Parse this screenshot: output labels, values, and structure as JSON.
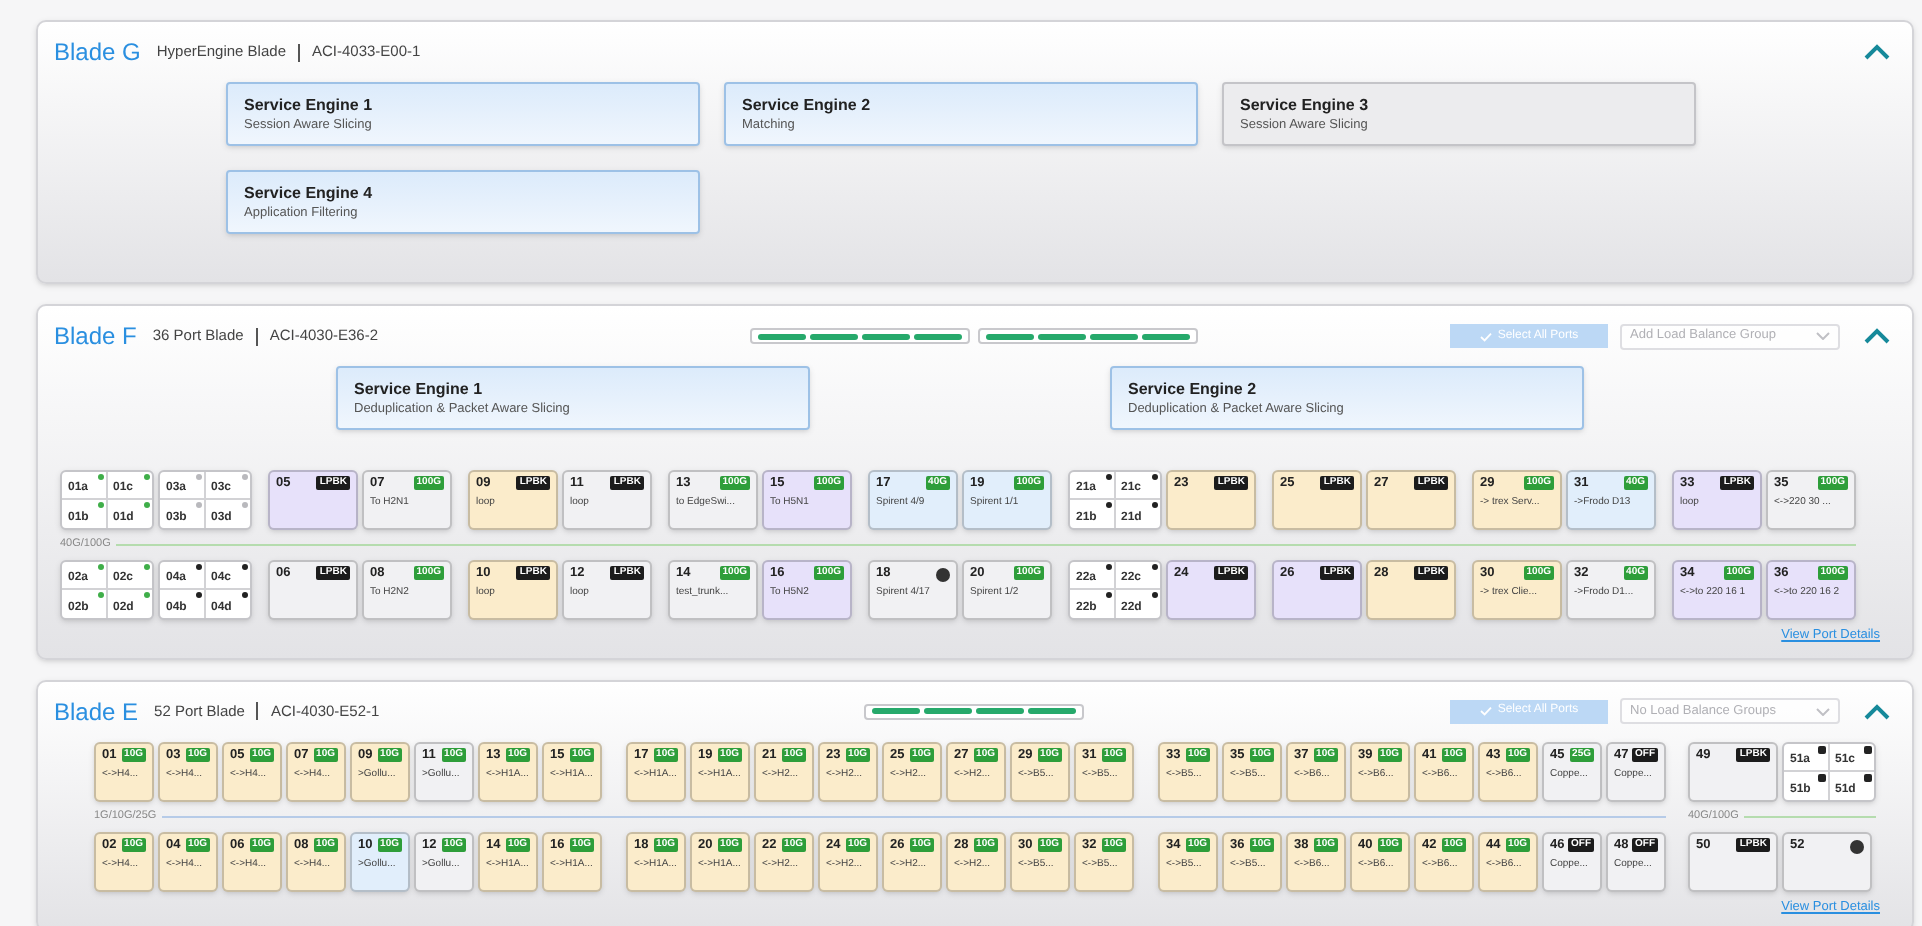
{
  "blades": [
    {
      "name": "Blade G",
      "type": "HyperEngine Blade",
      "model": "ACI-4033-E00-1",
      "expanded": true,
      "engines": [
        {
          "title": "Service Engine 1",
          "subtitle": "Session Aware Slicing",
          "active": true
        },
        {
          "title": "Service Engine 2",
          "subtitle": "Matching",
          "active": true
        },
        {
          "title": "Service Engine 3",
          "subtitle": "Session Aware Slicing",
          "active": false
        },
        {
          "title": "Service Engine 4",
          "subtitle": "Application Filtering",
          "active": true
        }
      ]
    },
    {
      "name": "Blade F",
      "type": "36 Port Blade",
      "model": "ACI-4030-E36-2",
      "expanded": true,
      "link_groups": [
        {
          "lanes": [
            {
              "up": true
            },
            {
              "up": true
            },
            {
              "up": true
            },
            {
              "up": true
            }
          ]
        },
        {
          "lanes": [
            {
              "up": true
            },
            {
              "up": true
            },
            {
              "up": true
            },
            {
              "up": true
            }
          ]
        }
      ],
      "select_all": {
        "label": "Select All Ports",
        "disabled": true
      },
      "load_balance": {
        "placeholder": "Add Load Balance Group",
        "disabled": true
      },
      "engines": [
        {
          "title": "Service Engine 1",
          "subtitle": "Deduplication & Packet Aware Slicing",
          "active": true
        },
        {
          "title": "Service Engine 2",
          "subtitle": "Deduplication & Packet Aware Slicing",
          "active": true
        }
      ],
      "sections": [
        {
          "speed": "40G/100G",
          "color": "#b5dcae",
          "groups": [
            {
              "columns": [
                {
                  "top": {
                    "kind": "split",
                    "ports": [
                      {
                        "id": "01a",
                        "kind": "dot",
                        "color": "#3fae49"
                      },
                      {
                        "id": "01c",
                        "kind": "dot",
                        "color": "#3fae49"
                      },
                      {
                        "id": "01b",
                        "kind": "dot",
                        "color": "#3fae49"
                      },
                      {
                        "id": "01d",
                        "kind": "dot",
                        "color": "#3fae49"
                      }
                    ]
                  },
                  "bottom": {
                    "kind": "split",
                    "ports": [
                      {
                        "id": "02a",
                        "kind": "dot",
                        "color": "#3fae49"
                      },
                      {
                        "id": "02c",
                        "kind": "dot",
                        "color": "#3fae49"
                      },
                      {
                        "id": "02b",
                        "kind": "dot",
                        "color": "#3fae49"
                      },
                      {
                        "id": "02d",
                        "kind": "dot",
                        "color": "#3fae49"
                      }
                    ]
                  }
                },
                {
                  "top": {
                    "kind": "split",
                    "ports": [
                      {
                        "id": "03a",
                        "kind": "dot",
                        "color": "#b9b9bd"
                      },
                      {
                        "id": "03c",
                        "kind": "dot",
                        "color": "#b9b9bd"
                      },
                      {
                        "id": "03b",
                        "kind": "dot",
                        "color": "#b9b9bd"
                      },
                      {
                        "id": "03d",
                        "kind": "dot",
                        "color": "#b9b9bd"
                      }
                    ]
                  },
                  "bottom": {
                    "kind": "split",
                    "ports": [
                      {
                        "id": "04a",
                        "kind": "dot",
                        "color": "#222222"
                      },
                      {
                        "id": "04c",
                        "kind": "dot",
                        "color": "#222222"
                      },
                      {
                        "id": "04b",
                        "kind": "dot",
                        "color": "#222222"
                      },
                      {
                        "id": "04d",
                        "kind": "dot",
                        "color": "#222222"
                      }
                    ]
                  }
                }
              ]
            },
            {
              "columns": [
                {
                  "top": {
                    "kind": "port",
                    "id": "05",
                    "badge": {
                      "kind": "dark",
                      "text": "LPBK"
                    },
                    "color": "#e7e1fa"
                  },
                  "bottom": {
                    "kind": "port",
                    "id": "06",
                    "badge": {
                      "kind": "dark",
                      "text": "LPBK"
                    },
                    "color": "#f1f1f3"
                  }
                },
                {
                  "top": {
                    "kind": "port",
                    "id": "07",
                    "badge": {
                      "kind": "green",
                      "text": "100G"
                    },
                    "label": "To H2N1",
                    "color": "#f1f1f3"
                  },
                  "bottom": {
                    "kind": "port",
                    "id": "08",
                    "badge": {
                      "kind": "green",
                      "text": "100G"
                    },
                    "label": "To H2N2",
                    "color": "#f1f1f3"
                  }
                }
              ]
            },
            {
              "columns": [
                {
                  "top": {
                    "kind": "port",
                    "id": "09",
                    "badge": {
                      "kind": "dark",
                      "text": "LPBK"
                    },
                    "label": "loop",
                    "color": "#fbeccb"
                  },
                  "bottom": {
                    "kind": "port",
                    "id": "10",
                    "badge": {
                      "kind": "dark",
                      "text": "LPBK"
                    },
                    "label": "loop",
                    "color": "#fbeccb"
                  }
                },
                {
                  "top": {
                    "kind": "port",
                    "id": "11",
                    "badge": {
                      "kind": "dark",
                      "text": "LPBK"
                    },
                    "label": "loop",
                    "color": "#f1f1f3"
                  },
                  "bottom": {
                    "kind": "port",
                    "id": "12",
                    "badge": {
                      "kind": "dark",
                      "text": "LPBK"
                    },
                    "label": "loop",
                    "color": "#f1f1f3"
                  }
                }
              ]
            },
            {
              "columns": [
                {
                  "top": {
                    "kind": "port",
                    "id": "13",
                    "badge": {
                      "kind": "green",
                      "text": "100G"
                    },
                    "label": "to EdgeSwi...",
                    "color": "#f1f1f3"
                  },
                  "bottom": {
                    "kind": "port",
                    "id": "14",
                    "badge": {
                      "kind": "green",
                      "text": "100G"
                    },
                    "label": "test_trunk...",
                    "color": "#f1f1f3"
                  }
                },
                {
                  "top": {
                    "kind": "port",
                    "id": "15",
                    "badge": {
                      "kind": "green",
                      "text": "100G"
                    },
                    "label": "To H5N1",
                    "color": "#e7e1fa"
                  },
                  "bottom": {
                    "kind": "port",
                    "id": "16",
                    "badge": {
                      "kind": "green",
                      "text": "100G"
                    },
                    "label": "To H5N2",
                    "color": "#e7e1fa"
                  }
                }
              ]
            },
            {
              "columns": [
                {
                  "top": {
                    "kind": "port",
                    "id": "17",
                    "badge": {
                      "kind": "green",
                      "text": "40G"
                    },
                    "label": "Spirent 4/9",
                    "color": "#e1eefb"
                  },
                  "bottom": {
                    "kind": "port",
                    "id": "18",
                    "badge": {
                      "kind": "dot"
                    },
                    "label": "Spirent 4/17",
                    "color": "#f1f1f3"
                  }
                },
                {
                  "top": {
                    "kind": "port",
                    "id": "19",
                    "badge": {
                      "kind": "green",
                      "text": "100G"
                    },
                    "label": "Spirent 1/1",
                    "color": "#e1eefb"
                  },
                  "bottom": {
                    "kind": "port",
                    "id": "20",
                    "badge": {
                      "kind": "green",
                      "text": "100G"
                    },
                    "label": "Spirent 1/2",
                    "color": "#f1f1f3"
                  }
                }
              ]
            },
            {
              "columns": [
                {
                  "top": {
                    "kind": "split",
                    "ports": [
                      {
                        "id": "21a",
                        "kind": "dot",
                        "color": "#222222"
                      },
                      {
                        "id": "21c",
                        "kind": "dot",
                        "color": "#222222"
                      },
                      {
                        "id": "21b",
                        "kind": "dot",
                        "color": "#222222"
                      },
                      {
                        "id": "21d",
                        "kind": "dot",
                        "color": "#222222"
                      }
                    ]
                  },
                  "bottom": {
                    "kind": "split",
                    "ports": [
                      {
                        "id": "22a",
                        "kind": "dot",
                        "color": "#222222"
                      },
                      {
                        "id": "22c",
                        "kind": "dot",
                        "color": "#222222"
                      },
                      {
                        "id": "22b",
                        "kind": "dot",
                        "color": "#222222"
                      },
                      {
                        "id": "22d",
                        "kind": "dot",
                        "color": "#222222"
                      }
                    ]
                  }
                },
                {
                  "top": {
                    "kind": "port",
                    "id": "23",
                    "badge": {
                      "kind": "dark",
                      "text": "LPBK"
                    },
                    "color": "#fbeccb"
                  },
                  "bottom": {
                    "kind": "port",
                    "id": "24",
                    "badge": {
                      "kind": "dark",
                      "text": "LPBK"
                    },
                    "color": "#e7e1fa"
                  }
                }
              ]
            },
            {
              "columns": [
                {
                  "top": {
                    "kind": "port",
                    "id": "25",
                    "badge": {
                      "kind": "dark",
                      "text": "LPBK"
                    },
                    "color": "#fbeccb"
                  },
                  "bottom": {
                    "kind": "port",
                    "id": "26",
                    "badge": {
                      "kind": "dark",
                      "text": "LPBK"
                    },
                    "color": "#e7e1fa"
                  }
                },
                {
                  "top": {
                    "kind": "port",
                    "id": "27",
                    "badge": {
                      "kind": "dark",
                      "text": "LPBK"
                    },
                    "color": "#fbeccb"
                  },
                  "bottom": {
                    "kind": "port",
                    "id": "28",
                    "badge": {
                      "kind": "dark",
                      "text": "LPBK"
                    },
                    "color": "#fbeccb"
                  }
                }
              ]
            },
            {
              "columns": [
                {
                  "top": {
                    "kind": "port",
                    "id": "29",
                    "badge": {
                      "kind": "green",
                      "text": "100G"
                    },
                    "label": "-> trex Serv...",
                    "color": "#fbeccb"
                  },
                  "bottom": {
                    "kind": "port",
                    "id": "30",
                    "badge": {
                      "kind": "green",
                      "text": "100G"
                    },
                    "label": "-> trex Clie...",
                    "color": "#fbeccb"
                  }
                },
                {
                  "top": {
                    "kind": "port",
                    "id": "31",
                    "badge": {
                      "kind": "green",
                      "text": "40G"
                    },
                    "label": "->Frodo D13",
                    "color": "#e1eefb"
                  },
                  "bottom": {
                    "kind": "port",
                    "id": "32",
                    "badge": {
                      "kind": "green",
                      "text": "40G"
                    },
                    "label": "->Frodo D1...",
                    "color": "#f1f1f3"
                  }
                }
              ]
            },
            {
              "columns": [
                {
                  "top": {
                    "kind": "port",
                    "id": "33",
                    "badge": {
                      "kind": "dark",
                      "text": "LPBK"
                    },
                    "label": "loop",
                    "color": "#e7e1fa"
                  },
                  "bottom": {
                    "kind": "port",
                    "id": "34",
                    "badge": {
                      "kind": "green",
                      "text": "100G"
                    },
                    "label": "<->to 220 16 1",
                    "color": "#e7e1fa"
                  }
                },
                {
                  "top": {
                    "kind": "port",
                    "id": "35",
                    "badge": {
                      "kind": "green",
                      "text": "100G"
                    },
                    "label": "<->220 30 ...",
                    "color": "#f1f1f3"
                  },
                  "bottom": {
                    "kind": "port",
                    "id": "36",
                    "badge": {
                      "kind": "green",
                      "text": "100G"
                    },
                    "label": "<->to 220 16 2",
                    "color": "#e7e1fa"
                  }
                }
              ]
            }
          ]
        }
      ],
      "details_link": "View Port Details"
    },
    {
      "name": "Blade E",
      "type": "52 Port Blade",
      "model": "ACI-4030-E52-1",
      "expanded": true,
      "link_groups": [
        {
          "lanes": [
            {
              "up": true
            },
            {
              "up": true
            },
            {
              "up": true
            },
            {
              "up": true
            }
          ]
        }
      ],
      "select_all": {
        "label": "Select All Ports",
        "disabled": true
      },
      "load_balance": {
        "placeholder": "No Load Balance Groups",
        "disabled": true
      },
      "sections": [
        {
          "speed": "1G/10G/25G",
          "color": "#b6cbe8",
          "groups": [
            {
              "columns": [
                {
                  "top": {
                    "kind": "port",
                    "id": "01",
                    "badge": {
                      "kind": "green",
                      "text": "10G"
                    },
                    "label": "<->H4...",
                    "color": "#fbeccb"
                  },
                  "bottom": {
                    "kind": "port",
                    "id": "02",
                    "badge": {
                      "kind": "green",
                      "text": "10G"
                    },
                    "label": "<->H4...",
                    "color": "#fbeccb"
                  }
                },
                {
                  "top": {
                    "kind": "port",
                    "id": "03",
                    "badge": {
                      "kind": "green",
                      "text": "10G"
                    },
                    "label": "<->H4...",
                    "color": "#fbeccb"
                  },
                  "bottom": {
                    "kind": "port",
                    "id": "04",
                    "badge": {
                      "kind": "green",
                      "text": "10G"
                    },
                    "label": "<->H4...",
                    "color": "#fbeccb"
                  }
                },
                {
                  "top": {
                    "kind": "port",
                    "id": "05",
                    "badge": {
                      "kind": "green",
                      "text": "10G"
                    },
                    "label": "<->H4...",
                    "color": "#fbeccb"
                  },
                  "bottom": {
                    "kind": "port",
                    "id": "06",
                    "badge": {
                      "kind": "green",
                      "text": "10G"
                    },
                    "label": "<->H4...",
                    "color": "#fbeccb"
                  }
                },
                {
                  "top": {
                    "kind": "port",
                    "id": "07",
                    "badge": {
                      "kind": "green",
                      "text": "10G"
                    },
                    "label": "<->H4...",
                    "color": "#fbeccb"
                  },
                  "bottom": {
                    "kind": "port",
                    "id": "08",
                    "badge": {
                      "kind": "green",
                      "text": "10G"
                    },
                    "label": "<->H4...",
                    "color": "#fbeccb"
                  }
                },
                {
                  "top": {
                    "kind": "port",
                    "id": "09",
                    "badge": {
                      "kind": "green",
                      "text": "10G"
                    },
                    "label": ">Gollu...",
                    "color": "#fbeccb"
                  },
                  "bottom": {
                    "kind": "port",
                    "id": "10",
                    "badge": {
                      "kind": "green",
                      "text": "10G"
                    },
                    "label": ">Gollu...",
                    "color": "#e1eefb"
                  }
                },
                {
                  "top": {
                    "kind": "port",
                    "id": "11",
                    "badge": {
                      "kind": "green",
                      "text": "10G"
                    },
                    "label": ">Gollu...",
                    "color": "#f1f1f3"
                  },
                  "bottom": {
                    "kind": "port",
                    "id": "12",
                    "badge": {
                      "kind": "green",
                      "text": "10G"
                    },
                    "label": ">Gollu...",
                    "color": "#f1f1f3"
                  }
                },
                {
                  "top": {
                    "kind": "port",
                    "id": "13",
                    "badge": {
                      "kind": "green",
                      "text": "10G"
                    },
                    "label": "<->H1A...",
                    "color": "#fbeccb"
                  },
                  "bottom": {
                    "kind": "port",
                    "id": "14",
                    "badge": {
                      "kind": "green",
                      "text": "10G"
                    },
                    "label": "<->H1A...",
                    "color": "#fbeccb"
                  }
                },
                {
                  "top": {
                    "kind": "port",
                    "id": "15",
                    "badge": {
                      "kind": "green",
                      "text": "10G"
                    },
                    "label": "<->H1A...",
                    "color": "#fbeccb"
                  },
                  "bottom": {
                    "kind": "port",
                    "id": "16",
                    "badge": {
                      "kind": "green",
                      "text": "10G"
                    },
                    "label": "<->H1A...",
                    "color": "#fbeccb"
                  }
                }
              ]
            },
            {
              "columns": [
                {
                  "top": {
                    "kind": "port",
                    "id": "17",
                    "badge": {
                      "kind": "green",
                      "text": "10G"
                    },
                    "label": "<->H1A...",
                    "color": "#fbeccb"
                  },
                  "bottom": {
                    "kind": "port",
                    "id": "18",
                    "badge": {
                      "kind": "green",
                      "text": "10G"
                    },
                    "label": "<->H1A...",
                    "color": "#fbeccb"
                  }
                },
                {
                  "top": {
                    "kind": "port",
                    "id": "19",
                    "badge": {
                      "kind": "green",
                      "text": "10G"
                    },
                    "label": "<->H1A...",
                    "color": "#fbeccb"
                  },
                  "bottom": {
                    "kind": "port",
                    "id": "20",
                    "badge": {
                      "kind": "green",
                      "text": "10G"
                    },
                    "label": "<->H1A...",
                    "color": "#fbeccb"
                  }
                },
                {
                  "top": {
                    "kind": "port",
                    "id": "21",
                    "badge": {
                      "kind": "green",
                      "text": "10G"
                    },
                    "label": "<->H2...",
                    "color": "#fbeccb"
                  },
                  "bottom": {
                    "kind": "port",
                    "id": "22",
                    "badge": {
                      "kind": "green",
                      "text": "10G"
                    },
                    "label": "<->H2...",
                    "color": "#fbeccb"
                  }
                },
                {
                  "top": {
                    "kind": "port",
                    "id": "23",
                    "badge": {
                      "kind": "green",
                      "text": "10G"
                    },
                    "label": "<->H2...",
                    "color": "#fbeccb"
                  },
                  "bottom": {
                    "kind": "port",
                    "id": "24",
                    "badge": {
                      "kind": "green",
                      "text": "10G"
                    },
                    "label": "<->H2...",
                    "color": "#fbeccb"
                  }
                },
                {
                  "top": {
                    "kind": "port",
                    "id": "25",
                    "badge": {
                      "kind": "green",
                      "text": "10G"
                    },
                    "label": "<->H2...",
                    "color": "#fbeccb"
                  },
                  "bottom": {
                    "kind": "port",
                    "id": "26",
                    "badge": {
                      "kind": "green",
                      "text": "10G"
                    },
                    "label": "<->H2...",
                    "color": "#fbeccb"
                  }
                },
                {
                  "top": {
                    "kind": "port",
                    "id": "27",
                    "badge": {
                      "kind": "green",
                      "text": "10G"
                    },
                    "label": "<->H2...",
                    "color": "#fbeccb"
                  },
                  "bottom": {
                    "kind": "port",
                    "id": "28",
                    "badge": {
                      "kind": "green",
                      "text": "10G"
                    },
                    "label": "<->H2...",
                    "color": "#fbeccb"
                  }
                },
                {
                  "top": {
                    "kind": "port",
                    "id": "29",
                    "badge": {
                      "kind": "green",
                      "text": "10G"
                    },
                    "label": "<->B5...",
                    "color": "#fbeccb"
                  },
                  "bottom": {
                    "kind": "port",
                    "id": "30",
                    "badge": {
                      "kind": "green",
                      "text": "10G"
                    },
                    "label": "<->B5...",
                    "color": "#fbeccb"
                  }
                },
                {
                  "top": {
                    "kind": "port",
                    "id": "31",
                    "badge": {
                      "kind": "green",
                      "text": "10G"
                    },
                    "label": "<->B5...",
                    "color": "#fbeccb"
                  },
                  "bottom": {
                    "kind": "port",
                    "id": "32",
                    "badge": {
                      "kind": "green",
                      "text": "10G"
                    },
                    "label": "<->B5...",
                    "color": "#fbeccb"
                  }
                }
              ]
            },
            {
              "columns": [
                {
                  "top": {
                    "kind": "port",
                    "id": "33",
                    "badge": {
                      "kind": "green",
                      "text": "10G"
                    },
                    "label": "<->B5...",
                    "color": "#fbeccb"
                  },
                  "bottom": {
                    "kind": "port",
                    "id": "34",
                    "badge": {
                      "kind": "green",
                      "text": "10G"
                    },
                    "label": "<->B5...",
                    "color": "#fbeccb"
                  }
                },
                {
                  "top": {
                    "kind": "port",
                    "id": "35",
                    "badge": {
                      "kind": "green",
                      "text": "10G"
                    },
                    "label": "<->B5...",
                    "color": "#fbeccb"
                  },
                  "bottom": {
                    "kind": "port",
                    "id": "36",
                    "badge": {
                      "kind": "green",
                      "text": "10G"
                    },
                    "label": "<->B5...",
                    "color": "#fbeccb"
                  }
                },
                {
                  "top": {
                    "kind": "port",
                    "id": "37",
                    "badge": {
                      "kind": "green",
                      "text": "10G"
                    },
                    "label": "<->B6...",
                    "color": "#fbeccb"
                  },
                  "bottom": {
                    "kind": "port",
                    "id": "38",
                    "badge": {
                      "kind": "green",
                      "text": "10G"
                    },
                    "label": "<->B6...",
                    "color": "#fbeccb"
                  }
                },
                {
                  "top": {
                    "kind": "port",
                    "id": "39",
                    "badge": {
                      "kind": "green",
                      "text": "10G"
                    },
                    "label": "<->B6...",
                    "color": "#fbeccb"
                  },
                  "bottom": {
                    "kind": "port",
                    "id": "40",
                    "badge": {
                      "kind": "green",
                      "text": "10G"
                    },
                    "label": "<->B6...",
                    "color": "#fbeccb"
                  }
                },
                {
                  "top": {
                    "kind": "port",
                    "id": "41",
                    "badge": {
                      "kind": "green",
                      "text": "10G"
                    },
                    "label": "<->B6...",
                    "color": "#fbeccb"
                  },
                  "bottom": {
                    "kind": "port",
                    "id": "42",
                    "badge": {
                      "kind": "green",
                      "text": "10G"
                    },
                    "label": "<->B6...",
                    "color": "#fbeccb"
                  }
                },
                {
                  "top": {
                    "kind": "port",
                    "id": "43",
                    "badge": {
                      "kind": "green",
                      "text": "10G"
                    },
                    "label": "<->B6...",
                    "color": "#fbeccb"
                  },
                  "bottom": {
                    "kind": "port",
                    "id": "44",
                    "badge": {
                      "kind": "green",
                      "text": "10G"
                    },
                    "label": "<->B6...",
                    "color": "#fbeccb"
                  }
                },
                {
                  "top": {
                    "kind": "port",
                    "id": "45",
                    "badge": {
                      "kind": "green",
                      "text": "25G"
                    },
                    "label": "Coppe...",
                    "color": "#f1f1f3"
                  },
                  "bottom": {
                    "kind": "port",
                    "id": "46",
                    "badge": {
                      "kind": "dark",
                      "text": "OFF"
                    },
                    "label": "Coppe...",
                    "color": "#f1f1f3"
                  }
                },
                {
                  "top": {
                    "kind": "port",
                    "id": "47",
                    "badge": {
                      "kind": "dark",
                      "text": "OFF"
                    },
                    "label": "Coppe...",
                    "color": "#f1f1f3"
                  },
                  "bottom": {
                    "kind": "port",
                    "id": "48",
                    "badge": {
                      "kind": "dark",
                      "text": "OFF"
                    },
                    "label": "Coppe...",
                    "color": "#f1f1f3"
                  }
                }
              ]
            }
          ]
        },
        {
          "speed": "40G/100G",
          "color": "#b5dcae",
          "groups": [
            {
              "columns": [
                {
                  "top": {
                    "kind": "port",
                    "id": "49",
                    "badge": {
                      "kind": "dark",
                      "text": "LPBK"
                    },
                    "color": "#f1f1f3"
                  },
                  "bottom": {
                    "kind": "port",
                    "id": "50",
                    "badge": {
                      "kind": "dark",
                      "text": "LPBK"
                    },
                    "color": "#f1f1f3"
                  }
                },
                {
                  "top": {
                    "kind": "split",
                    "ports": [
                      {
                        "id": "51a",
                        "kind": "square",
                        "color": "#222222"
                      },
                      {
                        "id": "51c",
                        "kind": "square",
                        "color": "#222222"
                      },
                      {
                        "id": "51b",
                        "kind": "square",
                        "color": "#222222"
                      },
                      {
                        "id": "51d",
                        "kind": "square",
                        "color": "#222222"
                      }
                    ]
                  },
                  "bottom": {
                    "kind": "port",
                    "id": "52",
                    "badge": {
                      "kind": "dot"
                    },
                    "color": "#f1f1f3"
                  }
                }
              ]
            }
          ]
        }
      ],
      "details_link": "View Port Details"
    }
  ]
}
